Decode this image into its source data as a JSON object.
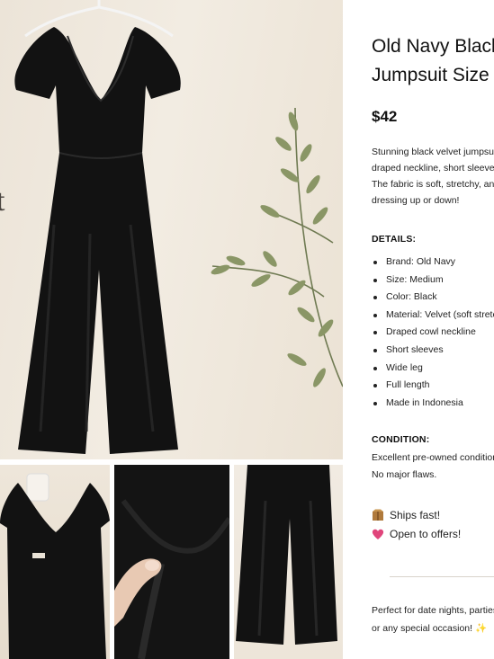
{
  "listing": {
    "title_line1": "Old Navy Black Velvet",
    "title_line2": "Jumpsuit Size Medium",
    "price": "$42",
    "description_lines": [
      "Stunning black velvet jumpsuit with a",
      "draped neckline, short sleeves, and wide legs.",
      "The fabric is soft, stretchy, and perfect for",
      "dressing up or down!"
    ],
    "details_heading": "DETAILS:",
    "details": [
      "Brand: Old Navy",
      "Size: Medium",
      "Color: Black",
      "Material: Velvet (soft stretch)",
      "Draped cowl neckline",
      "Short sleeves",
      "Wide leg",
      "Full length",
      "Made in Indonesia"
    ],
    "condition_heading": "CONDITION:",
    "condition_lines": [
      "Excellent pre-owned condition.",
      "No major flaws."
    ],
    "perks": [
      {
        "icon": "package-icon",
        "text": "Ships fast!"
      },
      {
        "icon": "heart-icon",
        "text": "Open to offers!"
      }
    ],
    "closing_lines": [
      "Perfect for date nights, parties,",
      "or any special occasion! ✨"
    ]
  },
  "gallery": {
    "main_side_letter": "t",
    "thumbnails": [
      "front-view",
      "fabric-closeup",
      "leg-detail"
    ]
  },
  "colors": {
    "garment": "#111111",
    "background": "#efe8dd",
    "accent_heart": "#e0457b",
    "accent_package": "#b07a3c"
  }
}
